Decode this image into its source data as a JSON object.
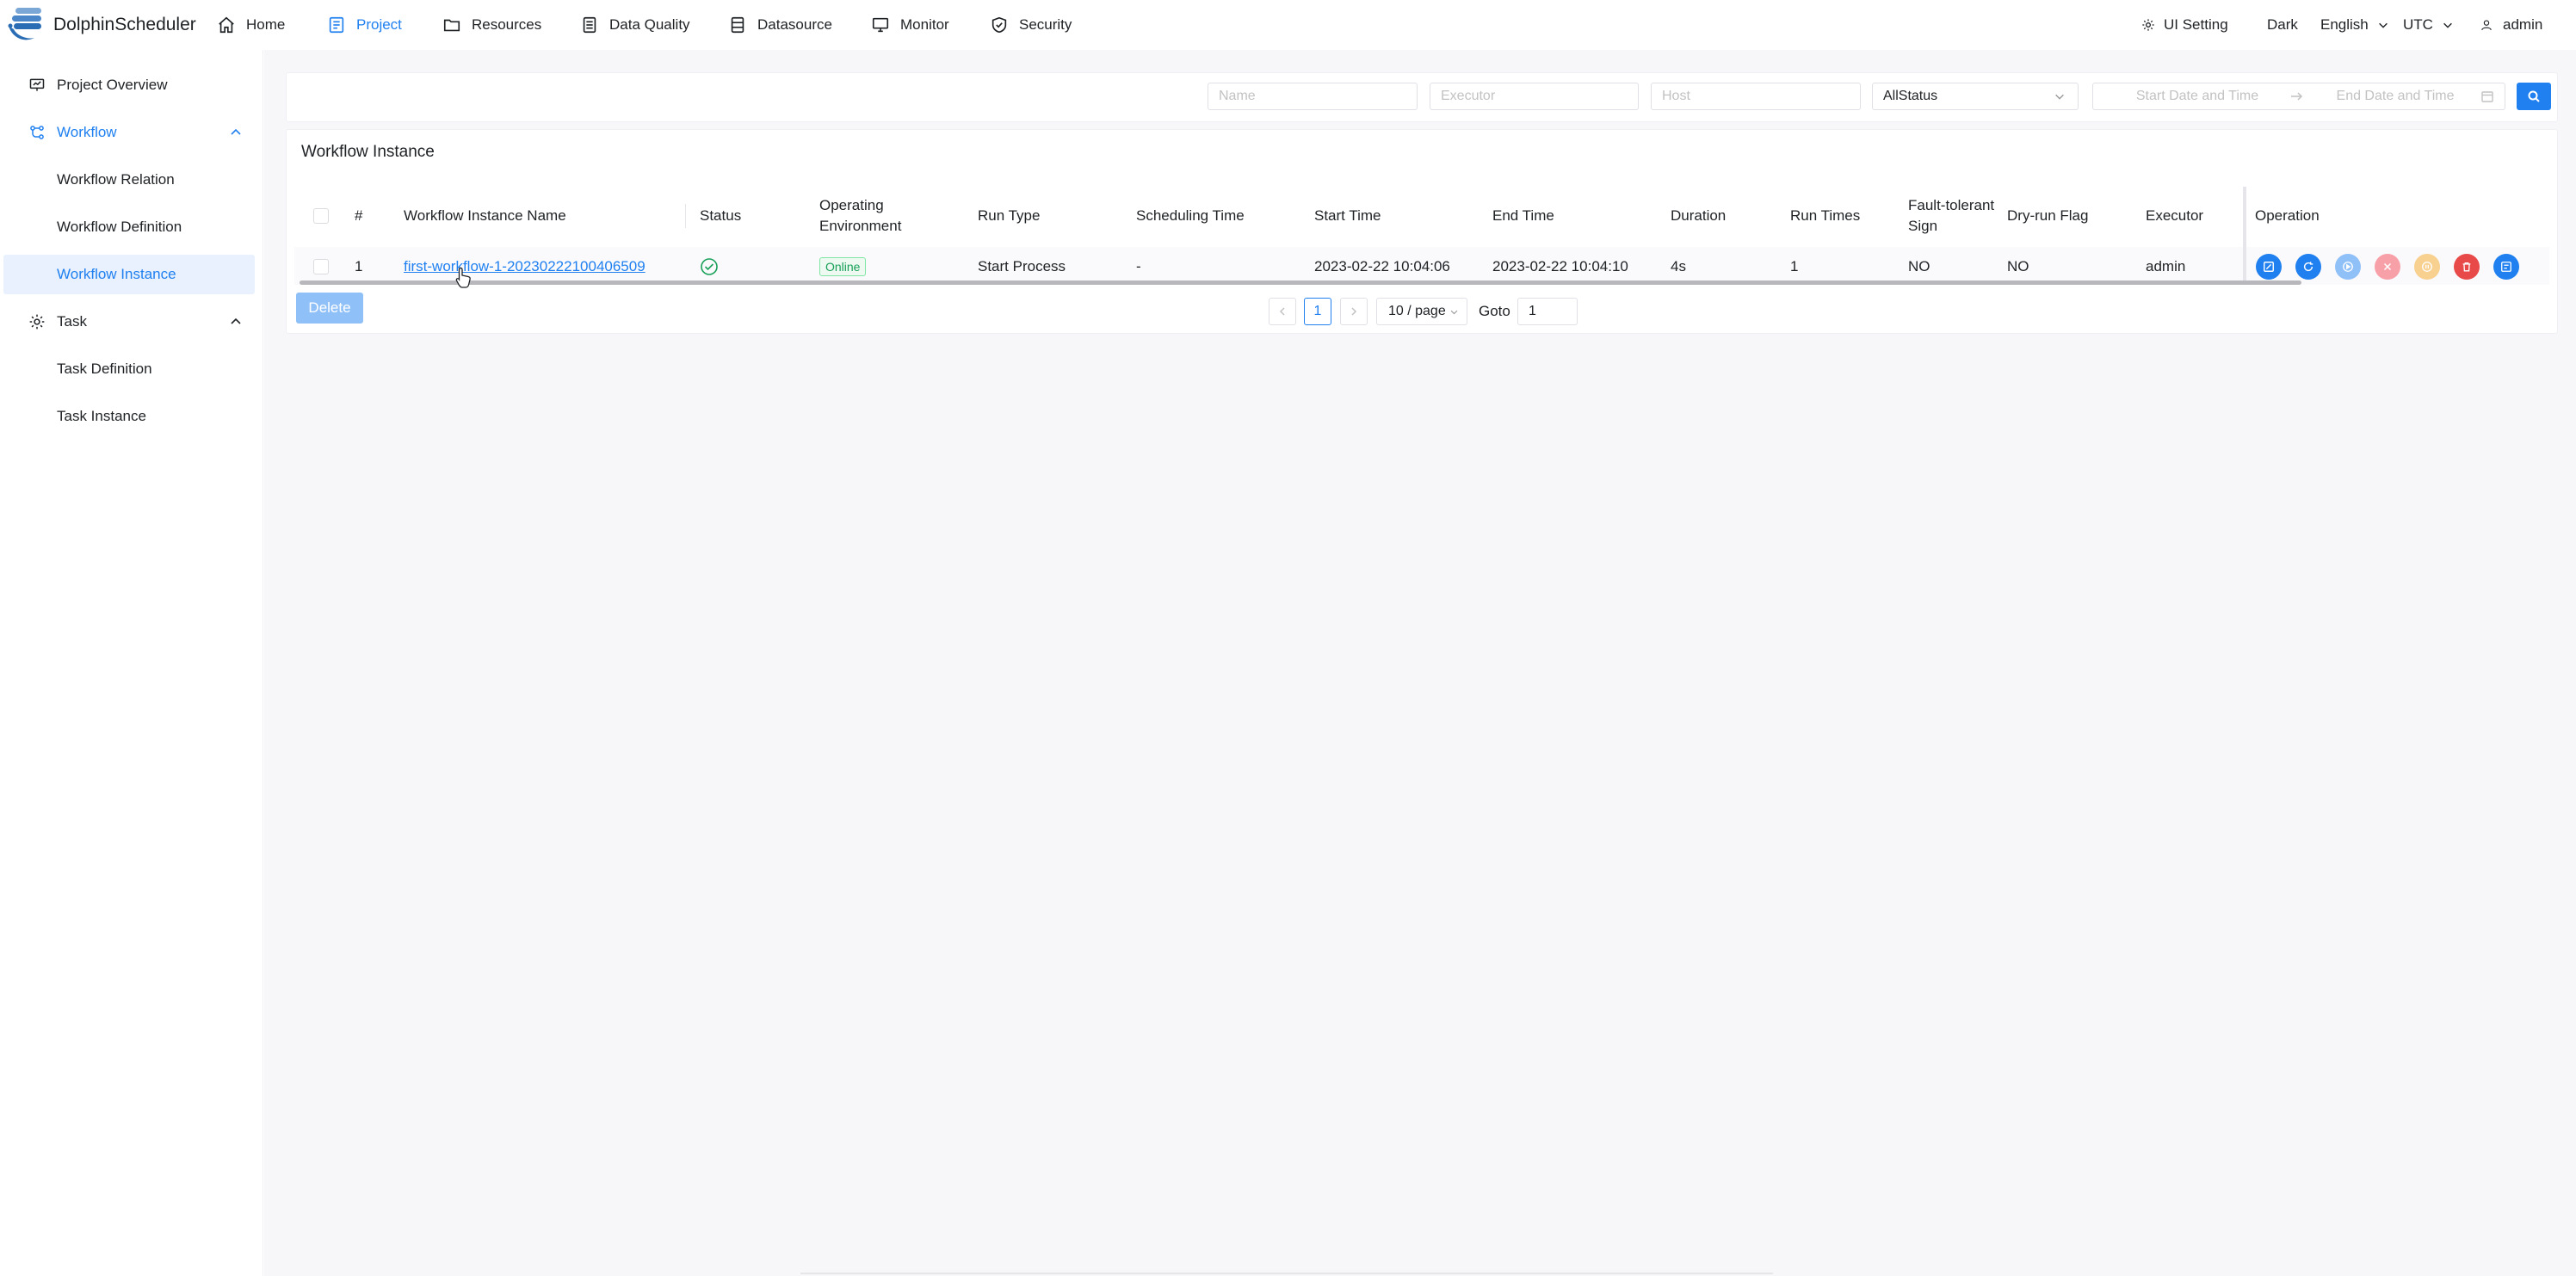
{
  "app": {
    "brand": "DolphinScheduler"
  },
  "nav": [
    {
      "label": "Home",
      "icon": "home-icon"
    },
    {
      "label": "Project",
      "icon": "project-icon",
      "active": true
    },
    {
      "label": "Resources",
      "icon": "folder-icon"
    },
    {
      "label": "Data Quality",
      "icon": "data-quality-icon"
    },
    {
      "label": "Datasource",
      "icon": "database-icon"
    },
    {
      "label": "Monitor",
      "icon": "monitor-icon"
    },
    {
      "label": "Security",
      "icon": "shield-icon"
    }
  ],
  "header_right": {
    "ui_setting": "UI Setting",
    "theme": "Dark",
    "language": "English",
    "timezone": "UTC",
    "user": "admin"
  },
  "sidebar": {
    "items": [
      {
        "label": "Project Overview"
      },
      {
        "label": "Workflow"
      },
      {
        "label": "Workflow Relation"
      },
      {
        "label": "Workflow Definition"
      },
      {
        "label": "Workflow Instance"
      },
      {
        "label": "Task"
      },
      {
        "label": "Task Definition"
      },
      {
        "label": "Task Instance"
      }
    ]
  },
  "filters": {
    "name_placeholder": "Name",
    "executor_placeholder": "Executor",
    "host_placeholder": "Host",
    "status_value": "AllStatus",
    "start_placeholder": "Start Date and Time",
    "end_placeholder": "End Date and Time"
  },
  "card": {
    "title": "Workflow Instance"
  },
  "table": {
    "headers": {
      "index": "#",
      "name": "Workflow Instance Name",
      "status": "Status",
      "env": "Operating Environment",
      "run_type": "Run Type",
      "sched_time": "Scheduling Time",
      "start_time": "Start Time",
      "end_time": "End Time",
      "duration": "Duration",
      "run_times": "Run Times",
      "fault": "Fault-tolerant Sign",
      "dry_run": "Dry-run Flag",
      "executor": "Executor",
      "operation": "Operation"
    },
    "rows": [
      {
        "index": "1",
        "name": "first-workflow-1-20230222100406509",
        "env": "Online",
        "run_type": "Start Process",
        "sched_time": "-",
        "start_time": "2023-02-22 10:04:06",
        "end_time": "2023-02-22 10:04:10",
        "duration": "4s",
        "run_times": "1",
        "fault": "NO",
        "dry_run": "NO",
        "executor": "admin"
      }
    ]
  },
  "actions": {
    "delete": "Delete"
  },
  "pagination": {
    "current": "1",
    "page_size": "10 / page",
    "goto_label": "Goto",
    "goto_value": "1"
  },
  "colors": {
    "primary": "#2080f0",
    "success": "#18a058",
    "error": "#d03050",
    "warning": "#f0a020"
  }
}
